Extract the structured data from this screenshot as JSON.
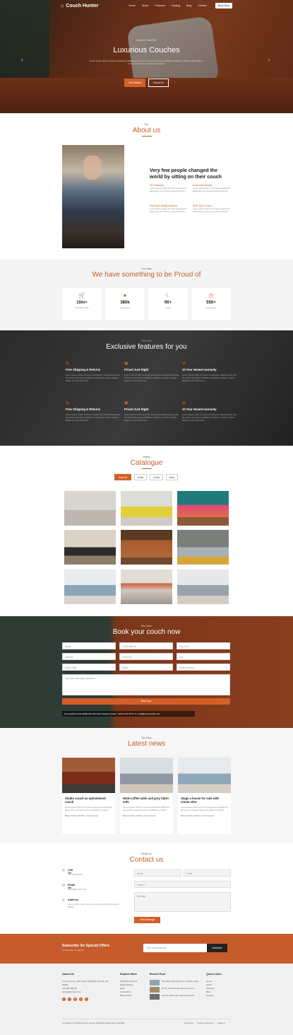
{
  "nav": {
    "logo": "Couch Hunter",
    "links": [
      "Home",
      "About",
      "Features",
      "Catalog",
      "Blog",
      "Contact"
    ],
    "cta": "Book Now"
  },
  "hero": {
    "kicker": "COUCH HUNTER",
    "title": "Luxurious Couches",
    "text": "Lorem ipsum dolor sit amet consectetur adipiscing elit sed do eiusmod tempor incididunt ut labore et dolore magna aliqua. Ut enim ad minim veniam quis nostrud.",
    "btn_primary": "Get Started",
    "btn_secondary": "About Us"
  },
  "about": {
    "kicker": "Our",
    "title": "About us",
    "heading": "Very few people changed the world by sitting on their couch",
    "items": [
      {
        "title": "DIY Hardware",
        "text": "Lorem ipsum dolor sit amet consectetur adipiscing elit sed do eiusmod tempor."
      },
      {
        "title": "Economical Market",
        "text": "Lorem ipsum dolor sit amet consectetur adipiscing elit sed do eiusmod tempor."
      },
      {
        "title": "Top-Rated Quality Materials",
        "text": "Lorem ipsum dolor sit amet consectetur adipiscing elit sed do eiusmod tempor."
      },
      {
        "title": "Wide Style Choices",
        "text": "Lorem ipsum dolor sit amet consectetur adipiscing elit sed do eiusmod tempor."
      }
    ]
  },
  "proud": {
    "kicker": "Our stats",
    "title": "We have something to be Proud of",
    "stats": [
      {
        "icon": "cart-icon",
        "value": "10m+",
        "label": "Products Sold"
      },
      {
        "icon": "user-icon",
        "value": "380k",
        "label": "Customers"
      },
      {
        "icon": "moon-icon",
        "value": "90+",
        "label": "Years"
      },
      {
        "icon": "clock-icon",
        "value": "550+",
        "label": "Employees"
      }
    ]
  },
  "features": {
    "kicker": "Our Pros",
    "title": "Exclusive features for you",
    "items": [
      {
        "icon": "truck-icon",
        "title": "Free Shipping & Returns",
        "text": "Lorem ipsum dolor sit amet consectetur adipiscing elit sed do eiusmod tempor incididunt ut labore et dolore magna aliqua ut enim ad minim."
      },
      {
        "icon": "tag-icon",
        "title": "Priced Just Right",
        "text": "Lorem ipsum dolor sit amet consectetur adipiscing elit sed do eiusmod tempor incididunt ut labore et dolore magna aliqua ut enim ad minim."
      },
      {
        "icon": "swap-icon",
        "title": "10 Year Honest warranty",
        "text": "Lorem ipsum dolor sit amet consectetur adipiscing elit sed do eiusmod tempor incididunt ut labore et dolore magna aliqua ut enim ad minim."
      },
      {
        "icon": "truck-icon",
        "title": "Free Shipping & Returns",
        "text": "Lorem ipsum dolor sit amet consectetur adipiscing elit sed do eiusmod tempor incididunt ut labore et dolore magna aliqua ut enim ad minim."
      },
      {
        "icon": "tag-icon",
        "title": "Priced Just Right",
        "text": "Lorem ipsum dolor sit amet consectetur adipiscing elit sed do eiusmod tempor incididunt ut labore et dolore magna aliqua ut enim ad minim."
      },
      {
        "icon": "swap-icon",
        "title": "10 Year Honest warranty",
        "text": "Lorem ipsum dolor sit amet consectetur adipiscing elit sed do eiusmod tempor incididunt ut labore et dolore magna aliqua ut enim ad minim."
      }
    ]
  },
  "catalogue": {
    "kicker": "Gallery",
    "title": "Catalogue",
    "tabs": [
      "Show All",
      "Sofas",
      "Chairs",
      "More"
    ],
    "images": [
      "#e7e4df",
      "#e9e6b0",
      "#c93c6b",
      "#6d6660",
      "#a0522d",
      "#8a8f8c",
      "#dfe6ea",
      "#d8d2c9",
      "#c9cfd2"
    ]
  },
  "booking": {
    "kicker": "Pre-Order",
    "title": "Book your couch now",
    "fields": [
      "Name",
      "Email address",
      "Phone no.",
      "Address",
      "Postcode",
      "City",
      "Select Style",
      "Fabric",
      "Select Delivery"
    ],
    "message": "Type your message (Optional)",
    "submit": "Book Now",
    "note": "For questions and additional information please contact: +46 (0) 123 45 67 or email@yourdomain.com"
  },
  "news": {
    "kicker": "Our Blog",
    "title": "Latest news",
    "cards": [
      {
        "title": "Studio couch an upholstered couch",
        "text": "Lorem ipsum dolor sit amet consectetur adipiscing elit sed do eiusmod tempor incididunt ut labore.",
        "meta": "Brian Smith  |  20 Mar  |  3 Comments"
      },
      {
        "title": "Wide coffee table and grey fabric sofa",
        "text": "Lorem ipsum dolor sit amet consectetur adipiscing elit sed do eiusmod tempor incididunt ut labore.",
        "meta": "Brian Smith  |  20 Mar  |  3 Comments"
      },
      {
        "title": "Stage a house for sale with cream view",
        "text": "Lorem ipsum dolor sit amet consectetur adipiscing elit sed do eiusmod tempor incididunt ut labore.",
        "meta": "Brian Smith  |  20 Mar  |  3 Comments"
      }
    ]
  },
  "contact": {
    "kicker": "Reach us",
    "title": "Contact us",
    "items": [
      {
        "icon": "phone-icon",
        "title": "Call Us",
        "value": "+44 000 000 00"
      },
      {
        "icon": "mail-icon",
        "title": "Email Us",
        "value": "name@domain.com"
      },
      {
        "icon": "pin-icon",
        "title": "Address",
        "value": "Lorem ipsum dolor sit amet, consectetur adipiscing elit, 00000"
      }
    ],
    "form": {
      "name": "Name",
      "email": "Email",
      "subject": "Subject",
      "message": "Message",
      "submit": "Send Message"
    }
  },
  "subscribe": {
    "title": "Subscribe for Special Offers",
    "subtitle": "Get Monthly Newsletter",
    "placeholder": "Enter email address",
    "button": "Subscribe"
  },
  "footer": {
    "about": {
      "title": "About Us",
      "text": "Couch Hunter, 25th Street, Flagstaff, Arizona, AZ, 00000",
      "phone": "+44 000 000 00",
      "email": "name@domain.com"
    },
    "explore": {
      "title": "Explore More",
      "links": [
        "Products Sold Out",
        "Refund Policy",
        "Help",
        "Instructions",
        "Buyer Guide"
      ]
    },
    "posts": {
      "title": "Recent Post",
      "items": [
        "The latest approaches to modern sofas",
        "Home sofa interiors ideas you love",
        "How to make your sofa look stylish"
      ]
    },
    "quick": {
      "title": "Quick Links",
      "links": [
        "Home",
        "About",
        "Services",
        "Blog",
        "Contact"
      ]
    },
    "copyright": "Copyright © All 2022 Couch Hunter. All Rights Reserved | WLOHB",
    "legal": [
      "Licensing",
      "Terms of Service",
      "Support"
    ]
  },
  "colors": {
    "accent": "#d35f2a",
    "dark": "#2b2b2b",
    "light": "#f4f4f4"
  }
}
